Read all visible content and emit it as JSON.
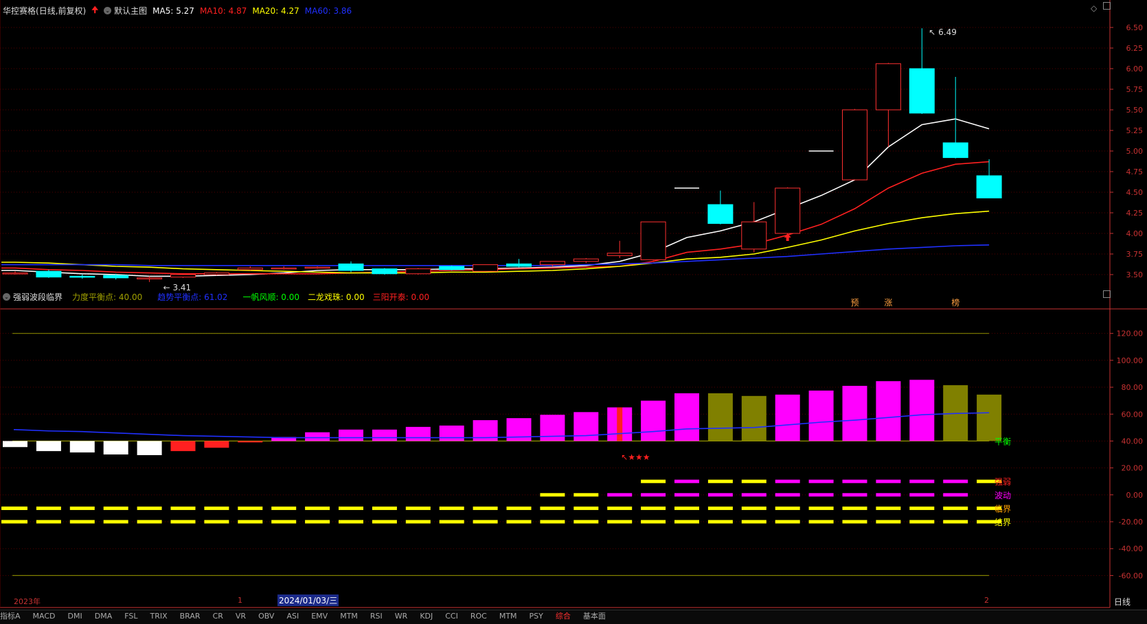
{
  "header": {
    "stock": "华控赛格",
    "period": "(日线,前复权)",
    "main_label": "默认主图",
    "ma": [
      {
        "label": "MA5: 5.27",
        "color": "#ffffff"
      },
      {
        "label": "MA10: 4.87",
        "color": "#ff2020"
      },
      {
        "label": "MA20: 4.27",
        "color": "#ffff00"
      },
      {
        "label": "MA60: 3.86",
        "color": "#2030ff"
      }
    ]
  },
  "indicator_header": {
    "name": "强弱波段临界",
    "items": [
      {
        "label": "力度平衡点: 40.00",
        "color": "#a0a000"
      },
      {
        "label": "趋势平衡点: 61.02",
        "color": "#2030ff"
      },
      {
        "label": "一帆风顺: 0.00",
        "color": "#00ff00"
      },
      {
        "label": "二龙戏珠: 0.00",
        "color": "#ffff00"
      },
      {
        "label": "三阳开泰: 0.00",
        "color": "#ff2020"
      }
    ]
  },
  "right_labels": {
    "period": "日线"
  },
  "time_axis": {
    "year": "2023年",
    "mark1": "1",
    "cursor_date": "2024/01/03/三",
    "mark2": "2"
  },
  "bottom_tabs": [
    "指标A",
    "MACD",
    "DMI",
    "DMA",
    "FSL",
    "TRIX",
    "BRAR",
    "CR",
    "VR",
    "OBV",
    "ASI",
    "EMV",
    "MTM",
    "RSI",
    "WR",
    "KDJ",
    "CCI",
    "ROC",
    "MTM",
    "PSY",
    "综合",
    "基本面"
  ],
  "colors": {
    "up": "#ff3030",
    "down": "#00ffff",
    "grid": "#5a0000",
    "axis": "#c83232"
  },
  "chart_data": [
    {
      "type": "candlestick",
      "title": "华控赛格 (日线,前复权)",
      "ylim": [
        3.35,
        6.6
      ],
      "yticks": [
        "6.50",
        "6.25",
        "6.00",
        "5.75",
        "5.50",
        "5.25",
        "5.00",
        "4.75",
        "4.50",
        "4.25",
        "4.00",
        "3.75",
        "3.50"
      ],
      "candles": [
        {
          "o": 3.52,
          "h": 3.54,
          "l": 3.5,
          "c": 3.52
        },
        {
          "o": 3.54,
          "h": 3.56,
          "l": 3.46,
          "c": 3.47
        },
        {
          "o": 3.48,
          "h": 3.5,
          "l": 3.45,
          "c": 3.47
        },
        {
          "o": 3.49,
          "h": 3.51,
          "l": 3.44,
          "c": 3.46
        },
        {
          "o": 3.45,
          "h": 3.48,
          "l": 3.41,
          "c": 3.46
        },
        {
          "o": 3.47,
          "h": 3.51,
          "l": 3.46,
          "c": 3.5
        },
        {
          "o": 3.5,
          "h": 3.53,
          "l": 3.49,
          "c": 3.52
        },
        {
          "o": 3.56,
          "h": 3.6,
          "l": 3.55,
          "c": 3.58
        },
        {
          "o": 3.58,
          "h": 3.6,
          "l": 3.56,
          "c": 3.58
        },
        {
          "o": 3.59,
          "h": 3.6,
          "l": 3.57,
          "c": 3.59
        },
        {
          "o": 3.63,
          "h": 3.66,
          "l": 3.53,
          "c": 3.55
        },
        {
          "o": 3.57,
          "h": 3.58,
          "l": 3.5,
          "c": 3.51
        },
        {
          "o": 3.51,
          "h": 3.58,
          "l": 3.5,
          "c": 3.57
        },
        {
          "o": 3.6,
          "h": 3.61,
          "l": 3.55,
          "c": 3.56
        },
        {
          "o": 3.54,
          "h": 3.62,
          "l": 3.54,
          "c": 3.62
        },
        {
          "o": 3.63,
          "h": 3.69,
          "l": 3.59,
          "c": 3.6
        },
        {
          "o": 3.62,
          "h": 3.66,
          "l": 3.6,
          "c": 3.66
        },
        {
          "o": 3.66,
          "h": 3.7,
          "l": 3.64,
          "c": 3.69
        },
        {
          "o": 3.73,
          "h": 3.91,
          "l": 3.7,
          "c": 3.76
        },
        {
          "o": 3.68,
          "h": 4.14,
          "l": 3.67,
          "c": 4.14
        },
        {
          "o": 4.55,
          "h": 4.55,
          "l": 4.55,
          "c": 4.55
        },
        {
          "o": 4.35,
          "h": 4.52,
          "l": 4.11,
          "c": 4.12
        },
        {
          "o": 3.81,
          "h": 4.38,
          "l": 3.77,
          "c": 4.14
        },
        {
          "o": 4.0,
          "h": 4.56,
          "l": 3.99,
          "c": 4.55
        },
        {
          "o": 5.0,
          "h": 5.0,
          "l": 5.0,
          "c": 5.0
        },
        {
          "o": 4.65,
          "h": 5.51,
          "l": 4.65,
          "c": 5.5
        },
        {
          "o": 5.5,
          "h": 6.07,
          "l": 5.05,
          "c": 6.06
        },
        {
          "o": 6.0,
          "h": 6.49,
          "l": 5.45,
          "c": 5.46
        },
        {
          "o": 5.1,
          "h": 5.9,
          "l": 4.91,
          "c": 4.92
        },
        {
          "o": 4.7,
          "h": 4.9,
          "l": 4.43,
          "c": 4.43
        }
      ],
      "ma_lines": [
        {
          "name": "MA5",
          "color": "#ffffff",
          "values": [
            3.55,
            3.53,
            3.51,
            3.5,
            3.48,
            3.48,
            3.49,
            3.5,
            3.52,
            3.55,
            3.56,
            3.56,
            3.56,
            3.57,
            3.57,
            3.58,
            3.59,
            3.61,
            3.66,
            3.77,
            3.95,
            4.03,
            4.14,
            4.3,
            4.46,
            4.65,
            5.05,
            5.32,
            5.39,
            5.27
          ]
        },
        {
          "name": "MA10",
          "color": "#ff2020",
          "values": [
            3.58,
            3.56,
            3.55,
            3.53,
            3.52,
            3.51,
            3.51,
            3.51,
            3.51,
            3.51,
            3.52,
            3.53,
            3.54,
            3.55,
            3.56,
            3.57,
            3.58,
            3.59,
            3.6,
            3.66,
            3.77,
            3.81,
            3.87,
            3.98,
            4.11,
            4.3,
            4.55,
            4.73,
            4.84,
            4.87
          ]
        },
        {
          "name": "MA20",
          "color": "#ffff00",
          "values": [
            3.65,
            3.64,
            3.62,
            3.6,
            3.59,
            3.57,
            3.56,
            3.55,
            3.54,
            3.53,
            3.52,
            3.52,
            3.52,
            3.53,
            3.53,
            3.54,
            3.55,
            3.57,
            3.6,
            3.64,
            3.69,
            3.71,
            3.75,
            3.83,
            3.92,
            4.03,
            4.12,
            4.19,
            4.24,
            4.27
          ]
        },
        {
          "name": "MA60",
          "color": "#2030ff",
          "values": [
            3.62,
            3.62,
            3.62,
            3.62,
            3.61,
            3.61,
            3.61,
            3.61,
            3.61,
            3.61,
            3.61,
            3.61,
            3.61,
            3.61,
            3.61,
            3.61,
            3.61,
            3.62,
            3.63,
            3.64,
            3.66,
            3.68,
            3.7,
            3.72,
            3.75,
            3.78,
            3.81,
            3.83,
            3.85,
            3.86
          ]
        }
      ],
      "annotations": [
        {
          "text": "3.41",
          "i": 4,
          "y": 3.41
        },
        {
          "text": "6.49",
          "i": 27,
          "y": 6.49
        },
        {
          "text": "预",
          "i": 25,
          "y": 3.45
        },
        {
          "text": "涨",
          "i": 26,
          "y": 3.45
        },
        {
          "text": "榜",
          "i": 28,
          "y": 3.45
        }
      ]
    },
    {
      "type": "bar",
      "title": "强弱波段临界",
      "ylim": [
        -70,
        128
      ],
      "yticks": [
        "120.00",
        "100.00",
        "80.00",
        "60.00",
        "40.00",
        "20.00",
        "0.00",
        "-20.00",
        "-40.00",
        "-60.00"
      ],
      "baseline": 40,
      "bars": [
        {
          "v": 35.5,
          "color": "#ffffff"
        },
        {
          "v": 32.5,
          "color": "#ffffff"
        },
        {
          "v": 31.5,
          "color": "#ffffff"
        },
        {
          "v": 30.0,
          "color": "#ffffff"
        },
        {
          "v": 29.5,
          "color": "#ffffff"
        },
        {
          "v": 32.5,
          "color": "#ff2020"
        },
        {
          "v": 35.0,
          "color": "#ff2020"
        },
        {
          "v": 39.0,
          "color": "#ff2020"
        },
        {
          "v": 43.0,
          "color": "#ff00ff"
        },
        {
          "v": 46.5,
          "color": "#ff00ff"
        },
        {
          "v": 48.5,
          "color": "#ff00ff"
        },
        {
          "v": 48.5,
          "color": "#ff00ff"
        },
        {
          "v": 50.5,
          "color": "#ff00ff"
        },
        {
          "v": 51.5,
          "color": "#ff00ff"
        },
        {
          "v": 55.5,
          "color": "#ff00ff"
        },
        {
          "v": 57.0,
          "color": "#ff00ff"
        },
        {
          "v": 59.5,
          "color": "#ff00ff"
        },
        {
          "v": 61.5,
          "color": "#ff00ff"
        },
        {
          "v": 65.0,
          "color": "#ff00ff"
        },
        {
          "v": 70.0,
          "color": "#ff00ff"
        },
        {
          "v": 75.5,
          "color": "#ff00ff"
        },
        {
          "v": 75.5,
          "color": "#808000"
        },
        {
          "v": 73.5,
          "color": "#808000"
        },
        {
          "v": 74.5,
          "color": "#ff00ff"
        },
        {
          "v": 77.5,
          "color": "#ff00ff"
        },
        {
          "v": 81.0,
          "color": "#ff00ff"
        },
        {
          "v": 84.5,
          "color": "#ff00ff"
        },
        {
          "v": 85.5,
          "color": "#ff00ff"
        },
        {
          "v": 81.5,
          "color": "#808000"
        },
        {
          "v": 74.5,
          "color": "#808000"
        }
      ],
      "trend_line": {
        "color": "#2030ff",
        "values": [
          48.5,
          47.5,
          47.0,
          46.0,
          45.0,
          44.0,
          43.5,
          43.0,
          42.5,
          42.5,
          42.5,
          42.5,
          42.5,
          42.5,
          42.5,
          43.0,
          43.5,
          44.0,
          45.5,
          47.0,
          49.0,
          49.5,
          50.0,
          52.0,
          54.0,
          55.5,
          57.5,
          59.5,
          60.5,
          61.02
        ]
      },
      "thresholds": [
        {
          "y": 120,
          "color": "#808000"
        },
        {
          "y": 40,
          "color": "#a0a000"
        },
        {
          "y": -60,
          "color": "#808000"
        }
      ],
      "dash_rows": [
        {
          "label": "强弱",
          "y": 10,
          "color": "#ff2020"
        },
        {
          "label": "波动",
          "y": 0,
          "color": "#ff00ff"
        },
        {
          "label": "临界",
          "y": -10,
          "color": "#ffa000"
        },
        {
          "label": "结界",
          "y": -20,
          "color": "#ffff00"
        }
      ],
      "dash_levels": {
        "row10": [
          null,
          null,
          null,
          null,
          null,
          null,
          null,
          null,
          null,
          null,
          null,
          null,
          null,
          null,
          null,
          null,
          null,
          null,
          null,
          "#ffff00",
          "#ff00ff",
          "#ffff00",
          "#ffff00",
          "#ff00ff",
          "#ff00ff",
          "#ff00ff",
          "#ff00ff",
          "#ff00ff",
          "#ff00ff",
          "#ffff00"
        ],
        "row0": [
          null,
          null,
          null,
          null,
          null,
          null,
          null,
          null,
          null,
          null,
          null,
          null,
          null,
          null,
          null,
          null,
          "#ffff00",
          "#ffff00",
          "#ff00ff",
          "#ff00ff",
          "#ff00ff",
          "#ff00ff",
          "#ff00ff",
          "#ff00ff",
          "#ff00ff",
          "#ff00ff",
          "#ff00ff",
          "#ff00ff",
          "#ff00ff",
          null
        ],
        "rowm10": "#ffff00",
        "rowm20": "#ffff00"
      },
      "signal_bar": {
        "i": 18,
        "from": 40,
        "to": 65,
        "color": "#ff2020"
      },
      "star_text": "↖★★★",
      "balance_label": "平衡"
    }
  ]
}
